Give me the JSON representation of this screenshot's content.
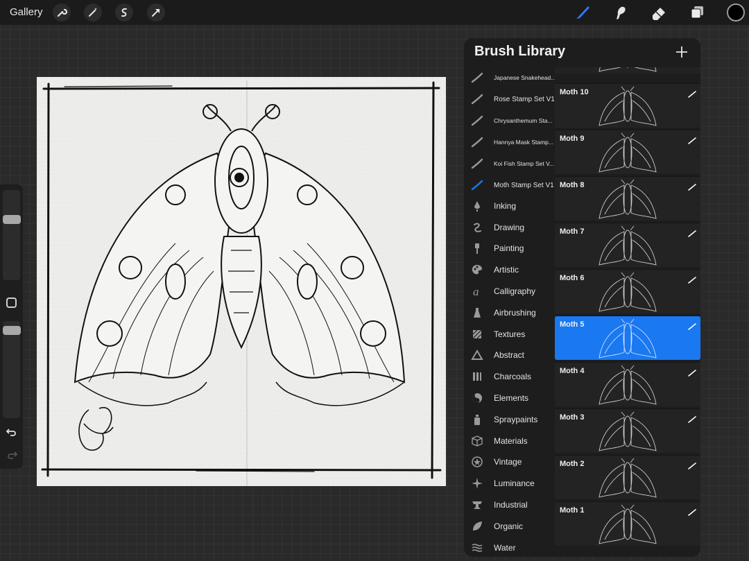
{
  "topbar": {
    "gallery_label": "Gallery",
    "left_tools": [
      "wrench-icon",
      "magic-wand-icon",
      "selection-icon",
      "transform-arrow-icon"
    ],
    "right_tools": [
      "brush-icon",
      "smudge-icon",
      "eraser-icon",
      "layers-icon"
    ],
    "active_color": "#000000",
    "accent": "#1a78f0"
  },
  "brush_library": {
    "title": "Brush Library",
    "categories": [
      {
        "label": "Japanese Snakehead...",
        "icon": "brush-stroke-icon"
      },
      {
        "label": "Rose Stamp Set V1",
        "icon": "brush-stroke-icon"
      },
      {
        "label": "Chrysanthemum Sta...",
        "icon": "brush-stroke-icon"
      },
      {
        "label": "Hannya Mask Stamp...",
        "icon": "brush-stroke-icon"
      },
      {
        "label": "Koi Fish Stamp Set V...",
        "icon": "brush-stroke-icon"
      },
      {
        "label": "Moth Stamp Set V1",
        "icon": "brush-stroke-icon",
        "selected": true
      },
      {
        "label": "Inking",
        "icon": "ink-drop-icon"
      },
      {
        "label": "Drawing",
        "icon": "squiggle-icon"
      },
      {
        "label": "Painting",
        "icon": "paint-brush-icon"
      },
      {
        "label": "Artistic",
        "icon": "palette-icon"
      },
      {
        "label": "Calligraphy",
        "icon": "calligraphy-icon"
      },
      {
        "label": "Airbrushing",
        "icon": "airbrush-icon"
      },
      {
        "label": "Textures",
        "icon": "texture-icon"
      },
      {
        "label": "Abstract",
        "icon": "triangle-icon"
      },
      {
        "label": "Charcoals",
        "icon": "charcoal-icon"
      },
      {
        "label": "Elements",
        "icon": "yin-yang-icon"
      },
      {
        "label": "Spraypaints",
        "icon": "spray-can-icon"
      },
      {
        "label": "Materials",
        "icon": "cube-icon"
      },
      {
        "label": "Vintage",
        "icon": "star-badge-icon"
      },
      {
        "label": "Luminance",
        "icon": "sparkle-icon"
      },
      {
        "label": "Industrial",
        "icon": "anvil-icon"
      },
      {
        "label": "Organic",
        "icon": "leaf-icon"
      },
      {
        "label": "Water",
        "icon": "waves-icon"
      }
    ],
    "brushes": [
      {
        "name": ""
      },
      {
        "name": "Moth 10"
      },
      {
        "name": "Moth 9"
      },
      {
        "name": "Moth 8"
      },
      {
        "name": "Moth 7"
      },
      {
        "name": "Moth 6"
      },
      {
        "name": "Moth 5",
        "selected": true
      },
      {
        "name": "Moth 4"
      },
      {
        "name": "Moth 3"
      },
      {
        "name": "Moth 2"
      },
      {
        "name": "Moth 1"
      }
    ]
  }
}
